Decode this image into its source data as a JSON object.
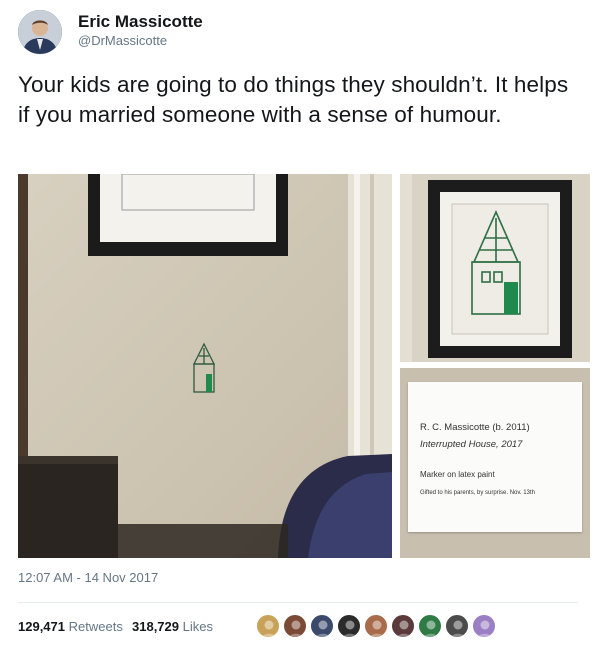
{
  "author": {
    "display_name": "Eric Massicotte",
    "handle": "@DrMassicotte"
  },
  "tweet": {
    "text": "Your kids are going to do things they shouldn’t. It helps if you married someone with a sense of humour.",
    "timestamp": "12:07 AM - 14 Nov 2017"
  },
  "media": {
    "label_card": {
      "artist": "R. C. Massicotte (b. 2011)",
      "title": "Interrupted House, 2017",
      "medium": "Marker on latex paint",
      "credit": "Gifted to his parents, by surprise. Nov. 13th"
    }
  },
  "stats": {
    "retweets_count": "129,471",
    "retweets_label": "Retweets",
    "likes_count": "318,729",
    "likes_label": "Likes"
  },
  "likers": [
    {
      "icon": "avatar-icon",
      "color": "#c9a25a"
    },
    {
      "icon": "avatar-icon",
      "color": "#7b4a36"
    },
    {
      "icon": "avatar-icon",
      "color": "#3b4a6b"
    },
    {
      "icon": "avatar-icon",
      "color": "#2b2b2b"
    },
    {
      "icon": "avatar-icon",
      "color": "#a86c4c"
    },
    {
      "icon": "avatar-icon",
      "color": "#5a3a3a"
    },
    {
      "icon": "avatar-icon",
      "color": "#2f7a45"
    },
    {
      "icon": "avatar-icon",
      "color": "#4b4b4b"
    },
    {
      "icon": "avatar-icon",
      "color": "#9b7fc4"
    }
  ],
  "colors": {
    "text_primary": "#14171a",
    "text_secondary": "#657786",
    "marker_green": "#1f8a4c"
  }
}
